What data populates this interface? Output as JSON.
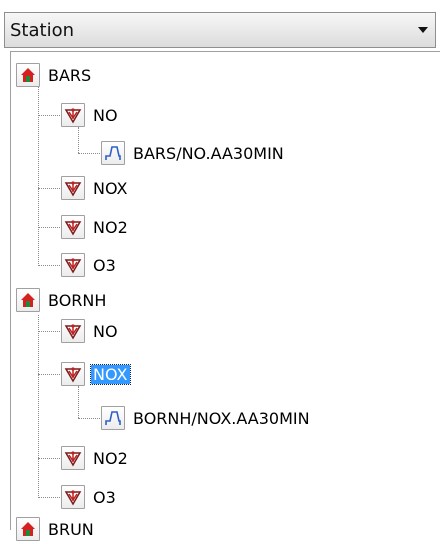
{
  "dropdown": {
    "selected": "Station"
  },
  "tree": {
    "stations": [
      {
        "label": "BARS",
        "children": [
          {
            "label": "NO",
            "series": "BARS/NO.AA30MIN"
          },
          {
            "label": "NOX"
          },
          {
            "label": "NO2"
          },
          {
            "label": "O3"
          }
        ]
      },
      {
        "label": "BORNH",
        "children": [
          {
            "label": "NO"
          },
          {
            "label": "NOX",
            "selected": true,
            "series": "BORNH/NOX.AA30MIN"
          },
          {
            "label": "NO2"
          },
          {
            "label": "O3"
          }
        ]
      },
      {
        "label": "BRUN",
        "children": []
      }
    ]
  },
  "icons": {
    "station": "house-icon",
    "component": "pollutant-component-icon",
    "series": "timeseries-icon"
  }
}
